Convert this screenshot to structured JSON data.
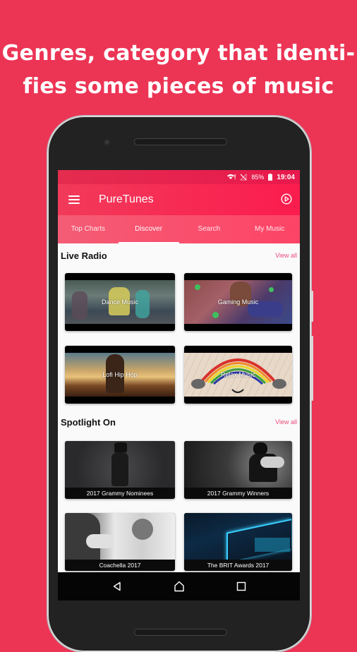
{
  "headline": {
    "line1": "Genres, category that identi-",
    "line2": "fies some pieces of music"
  },
  "status_bar": {
    "wifi_icon": "wifi-alert-icon",
    "signal_icon": "no-signal-icon",
    "battery": "85%",
    "battery_icon": "battery-icon",
    "time": "19:04"
  },
  "app_bar": {
    "menu_icon": "hamburger-menu-icon",
    "title": "PureTunes",
    "action_icon": "play-circle-icon"
  },
  "tabs": [
    {
      "label": "Top Charts",
      "active": false
    },
    {
      "label": "Discover",
      "active": true
    },
    {
      "label": "Search",
      "active": false
    },
    {
      "label": "My Music",
      "active": false
    }
  ],
  "live_radio": {
    "title": "Live Radio",
    "view_all": "View all",
    "items": [
      {
        "label": "Dance Music"
      },
      {
        "label": "Gaming Music"
      },
      {
        "label": "Lofi Hip Hop"
      },
      {
        "label": "Relax Music"
      }
    ]
  },
  "spotlight": {
    "title": "Spotlight On",
    "view_all": "View all",
    "items": [
      {
        "label": "2017 Grammy Nominees"
      },
      {
        "label": "2017 Grammy Winners"
      },
      {
        "label": "Coachella 2017"
      },
      {
        "label": "The BRIT Awards 2017"
      }
    ]
  },
  "nav_bar": {
    "back_icon": "back-triangle-icon",
    "home_icon": "home-icon",
    "recents_icon": "recents-square-icon"
  },
  "colors": {
    "background": "#ec3455",
    "app_bar": "#f7264f",
    "tab_bar": "#fa5070",
    "accent": "#ea4b7a"
  }
}
